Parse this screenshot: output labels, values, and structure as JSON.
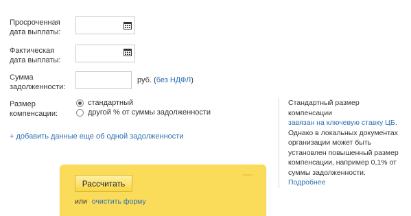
{
  "form": {
    "overdue_date_label": "Просроченная\nдата выплаты:",
    "overdue_date_value": "",
    "actual_date_label": "Фактическая\nдата выплаты:",
    "actual_date_value": "",
    "debt_amount_label": "Сумма\nзадолженности:",
    "debt_amount_value": "",
    "currency_prefix": "руб. (",
    "no_ndfl_link": "без НДФЛ",
    "currency_suffix": ")",
    "compensation_label": "Размер\nкомпенсации:",
    "radio_standard": "стандартный",
    "radio_other": "другой % от суммы задолженности",
    "add_debt_link": "+ добавить данные еще об одной задолженности"
  },
  "info": {
    "line1": "Стандартный размер компенсации",
    "link_key_rate": "завязан на ключевую ставку ЦБ",
    "after_link": ".",
    "body": "Однако в локальных документах организации может быть установлен повышенный размер компенсации, например 0,1% от суммы задолженности.",
    "more_link": "Подробнее"
  },
  "calc": {
    "button_label": "Рассчитать",
    "or_text": "или",
    "clear_link": "очистить форму"
  },
  "icons": {
    "calendar": "calendar-icon"
  }
}
